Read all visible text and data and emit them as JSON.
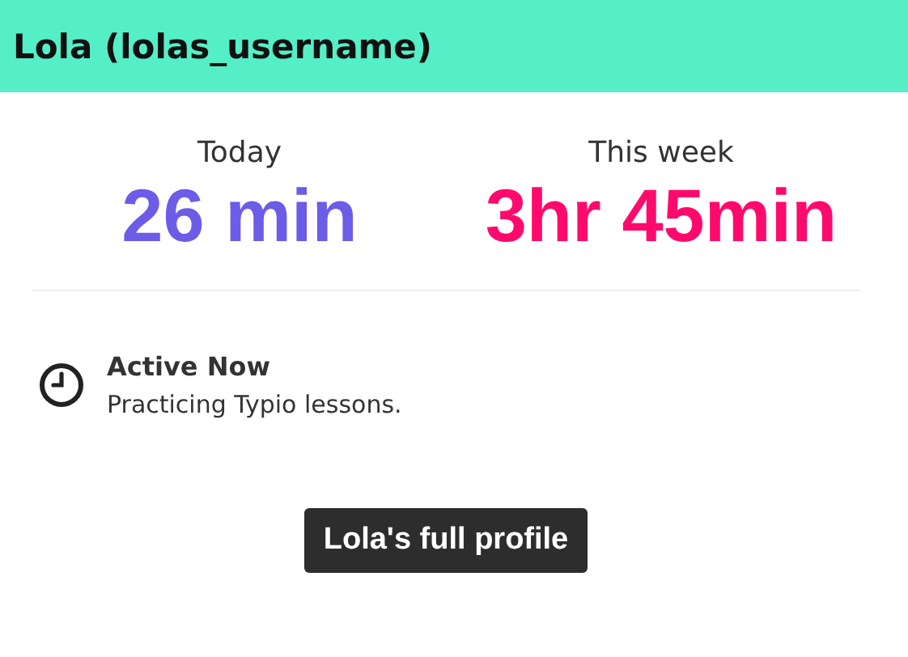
{
  "header": {
    "title": "Lola (lolas_username)"
  },
  "stats": [
    {
      "label": "Today",
      "value": "26 min",
      "color": "#6c5ce7"
    },
    {
      "label": "This week",
      "value": "3hr 45min",
      "color": "#ff0a6c"
    }
  ],
  "activity": {
    "title": "Active Now",
    "detail": "Practicing Typio lessons."
  },
  "button": {
    "label": "Lola's full profile"
  }
}
